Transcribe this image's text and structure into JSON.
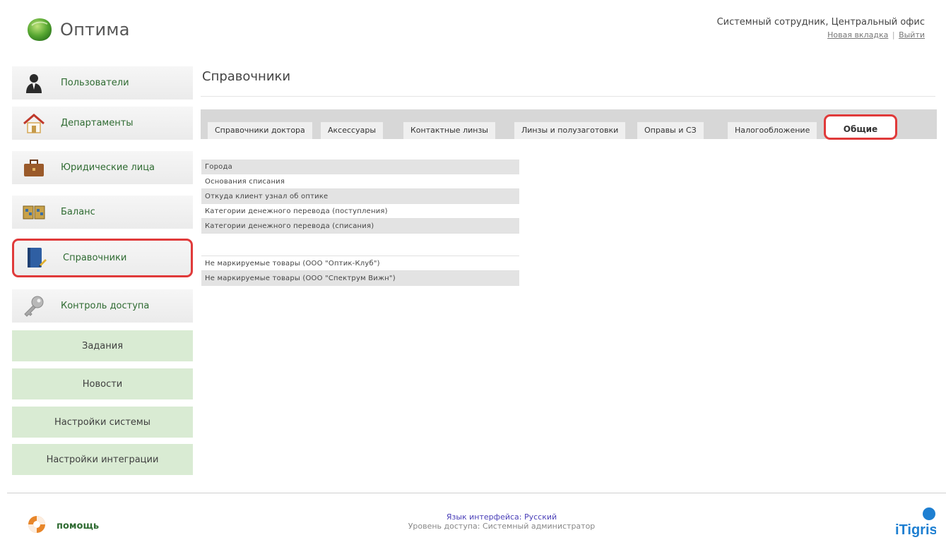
{
  "app": {
    "name": "Оптима"
  },
  "user": {
    "name": "Системный сотрудник, Центральный офис",
    "new_tab": "Новая вкладка",
    "separator": "|",
    "logout": "Выйти"
  },
  "sidebar": {
    "items": [
      {
        "label": "Пользователи",
        "icon": "user-icon"
      },
      {
        "label": "Департаменты",
        "icon": "house-icon"
      },
      {
        "label": "Юридические лица",
        "icon": "briefcase-icon"
      },
      {
        "label": "Баланс",
        "icon": "balance-icon"
      },
      {
        "label": "Справочники",
        "icon": "book-icon",
        "active": true
      },
      {
        "label": "Контроль доступа",
        "icon": "key-icon"
      }
    ],
    "buttons": [
      "Задания",
      "Новости",
      "Настройки системы",
      "Настройки интеграции"
    ]
  },
  "main": {
    "title": "Справочники",
    "tabs": [
      {
        "label": "Справочники доктора"
      },
      {
        "label": "Аксессуары"
      },
      {
        "label": "Контактные линзы"
      },
      {
        "label": "Линзы и полузаготовки"
      },
      {
        "label": "Оправы и СЗ"
      },
      {
        "label": "Налогообложение"
      },
      {
        "label": "Общие",
        "active": true
      }
    ],
    "list1": [
      "Города",
      "Основания списания",
      "Откуда клиент узнал об оптике",
      "Категории денежного перевода (поступления)",
      "Категории денежного перевода (списания)"
    ],
    "list2": [
      "Не маркируемые товары (ООО \"Оптик-Клуб\")",
      "Не маркируемые товары (ООО \"Спектрум Вижн\")"
    ]
  },
  "footer": {
    "help": "помощь",
    "language": "Язык интерфейса: Русский",
    "access_level": "Уровень доступа: Системный администратор",
    "brand": "iTigris"
  },
  "colors": {
    "accent_green": "#2f6b32",
    "highlight_red": "#e03a3a",
    "button_green": "#d9ebd3",
    "brand_blue": "#1e7fd1"
  }
}
